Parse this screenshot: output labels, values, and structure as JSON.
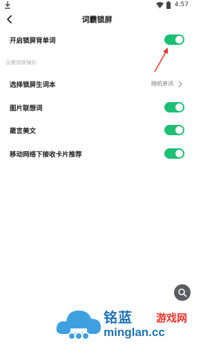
{
  "status_bar": {
    "time": "4:57",
    "download_icon": "download-icon",
    "wifi_icon": "wifi-icon",
    "battery_icon": "battery-icon"
  },
  "nav": {
    "title": "词霸锁屏",
    "back_icon": "chevron-left-icon"
  },
  "settings": {
    "lock_screen": {
      "label": "开启锁屏背单词",
      "enabled": true
    },
    "section_header": "设置锁屏偏好",
    "vocab_book": {
      "label": "选择锁屏生词本",
      "value": "随机单词",
      "icon": "chevron-right-icon"
    },
    "image_association": {
      "label": "图片联想词",
      "enabled": true
    },
    "quotes": {
      "label": "箴言美文",
      "enabled": true
    },
    "mobile_network_cards": {
      "label": "移动网络下接收卡片推荐",
      "enabled": true
    }
  },
  "fab": {
    "icon": "search-icon"
  },
  "watermark": {
    "text_cn_blue": "铭蓝",
    "text_cn_red": "游戏网",
    "text_domain": "minglan.cc"
  },
  "colors": {
    "toggle_on": "#1dbf73",
    "annotation_arrow": "#e8342a",
    "watermark_blue": "#1d71b8",
    "watermark_red": "#e8342a"
  }
}
